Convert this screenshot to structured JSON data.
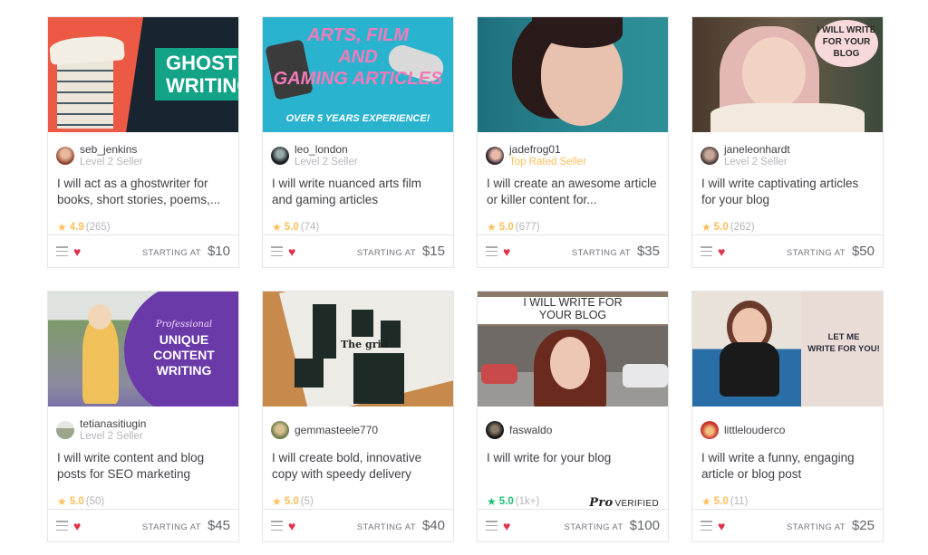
{
  "footer_label": "STARTING AT",
  "gigs": [
    {
      "seller": "seb_jenkins",
      "level": "Level 2 Seller",
      "title": "I will act as a ghostwriter for books, short stories, poems,...",
      "rating": "4.9",
      "count": "(265)",
      "price": "$10",
      "thumb_text": [
        "GHOST",
        "WRITING"
      ]
    },
    {
      "seller": "leo_london",
      "level": "Level 2 Seller",
      "title": "I will write nuanced arts film and gaming articles",
      "rating": "5.0",
      "count": "(74)",
      "price": "$15",
      "thumb_text": [
        "ARTS, FILM",
        "AND",
        "GAMING ARTICLES",
        "OVER 5 YEARS EXPERIENCE!"
      ]
    },
    {
      "seller": "jadefrog01",
      "level": "Top Rated Seller",
      "title": "I will create an awesome article or killer content for...",
      "rating": "5.0",
      "count": "(677)",
      "price": "$35",
      "thumb_text": []
    },
    {
      "seller": "janeleonhardt",
      "level": "Level 2 Seller",
      "title": "I will write captivating articles for your blog",
      "rating": "5.0",
      "count": "(262)",
      "price": "$50",
      "thumb_text": [
        "I WILL WRITE",
        "FOR YOUR",
        "BLOG"
      ]
    },
    {
      "seller": "tetianasitiugin",
      "level": "Level 2 Seller",
      "title": "I will write content and blog posts for SEO marketing",
      "rating": "5.0",
      "count": "(50)",
      "price": "$45",
      "thumb_text": [
        "Professional",
        "UNIQUE",
        "CONTENT",
        "WRITING"
      ]
    },
    {
      "seller": "gemmasteele770",
      "level": "",
      "title": "I will create bold, innovative copy with speedy delivery",
      "rating": "5.0",
      "count": "(5)",
      "price": "$40",
      "thumb_text": [
        "The grid"
      ]
    },
    {
      "seller": "faswaldo",
      "level": "",
      "title": "I will write for your blog",
      "rating": "5.0",
      "count": "(1k+)",
      "price": "$100",
      "badge_pro": "Pro",
      "badge_verified": "VERIFIED",
      "thumb_text": [
        "I WILL WRITE FOR",
        "YOUR BLOG"
      ]
    },
    {
      "seller": "littlelouderco",
      "level": "",
      "title": "I will write a funny, engaging article or blog post",
      "rating": "5.0",
      "count": "(11)",
      "price": "$25",
      "thumb_text": [
        "LET ME",
        "WRITE FOR YOU!"
      ]
    }
  ],
  "colors": {
    "star_yellow": "#ffbe5b",
    "star_green": "#1dbf73",
    "heart_red": "#e0314b",
    "top_rated": "#ffbe5b"
  }
}
